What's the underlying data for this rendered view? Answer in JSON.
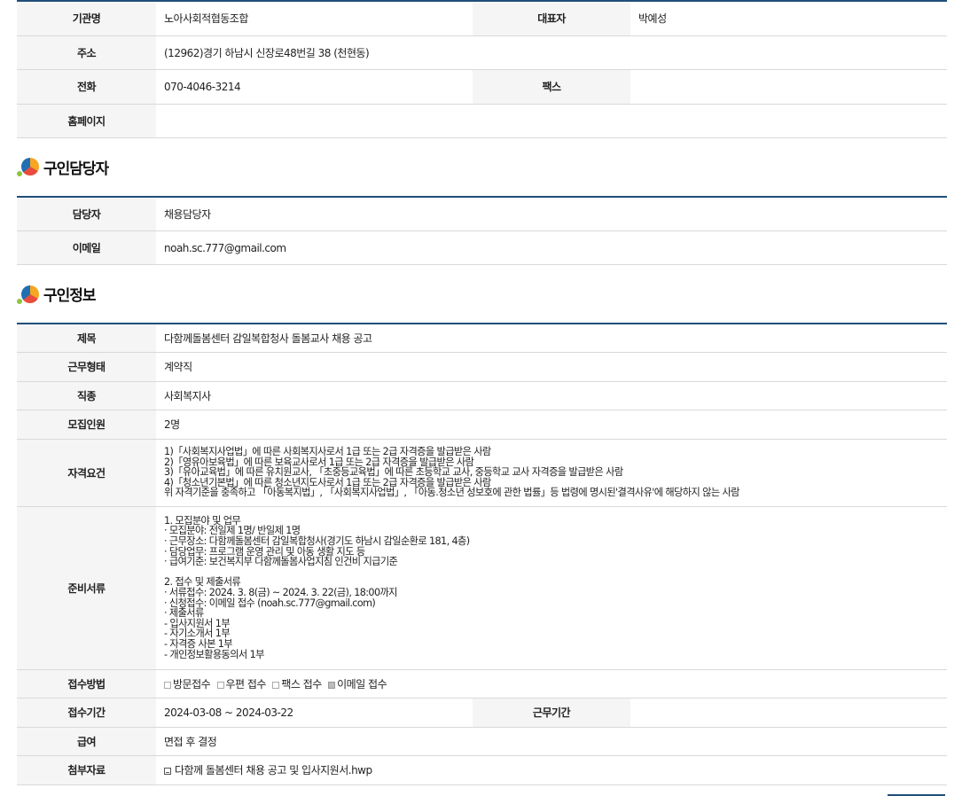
{
  "org": {
    "name_label": "기관명",
    "name_value": "노아사회적협동조합",
    "rep_label": "대표자",
    "rep_value": "박예성",
    "addr_label": "주소",
    "addr_value": "(12962)경기 하남시 신장로48번길 38 (천현동)",
    "tel_label": "전화",
    "tel_value": "070-4046-3214",
    "fax_label": "팩스",
    "fax_value": "",
    "home_label": "홈페이지",
    "home_value": ""
  },
  "contact": {
    "title": "구인담당자",
    "person_label": "담당자",
    "person_value": "채용담당자",
    "email_label": "이메일",
    "email_value": "noah.sc.777@gmail.com"
  },
  "job": {
    "title": "구인정보",
    "subject_label": "제목",
    "subject_value": "다함께돌봄센터 감일복합청사 돌봄교사 채용 공고",
    "type_label": "근무형태",
    "type_value": "계약직",
    "occ_label": "직종",
    "occ_value": "사회복지사",
    "count_label": "모집인원",
    "count_value": "2명",
    "qual_label": "자격요건",
    "qual_value": "1)「사회복지사업법」에 따른 사회복지사로서 1급 또는 2급 자격증을 발급받은 사람\n2)「영유아보육법」에 따른 보육교사로서 1급 또는 2급 자격증을 발급받은 사람\n3)「유아교육법」에 따른 유치원교사, 「초중등교육법」에 따른 초등학교 교사, 중등학교 교사 자격증을 발급받은 사람\n4)「청소년기본법」에 따른 청소년지도사로서 1급 또는 2급 자격증을 발급받은 사람\n위 자격기준을 충족하고 「아동복지법」, 「사회복지사업법」, 「아동.청소년 성보호에 관한 법률」등 법령에 명시된'결격사유'에 해당하지 않는 사람",
    "docs_label": "준비서류",
    "docs_value": "1. 모집분야 및 업무\n· 모집분야: 전일제 1명/ 반일제 1명\n· 근무장소: 다함께돌봄센터 감일복합청사(경기도 하남시 감일순환로 181, 4층)\n· 담당업무: 프로그램 운영 관리 및 아동 생활 지도 등\n· 급여기준: 보건복지부 다함께돌봄사업지침 인건비 지급기준\n\n2. 접수 및 제출서류\n· 서류접수: 2024. 3. 8(금) ~ 2024. 3. 22(금), 18:00까지\n· 신청접수: 이메일 접수 (noah.sc.777@gmail.com)\n· 제출서류\n- 입사지원서 1부\n- 자기소개서 1부\n- 자격증 사본 1부\n- 개인정보활용동의서 1부",
    "method_label": "접수방법",
    "methods": [
      {
        "label": "방문접수",
        "checked": false
      },
      {
        "label": "우편 접수",
        "checked": false
      },
      {
        "label": "팩스 접수",
        "checked": false
      },
      {
        "label": "이메일 접수",
        "checked": true
      }
    ],
    "period_label": "접수기간",
    "period_value": "2024-03-08 ~ 2024-03-22",
    "workperiod_label": "근무기간",
    "workperiod_value": "",
    "salary_label": "급여",
    "salary_value": "면접 후 결정",
    "attach_label": "첨부자료",
    "attach_value": "다함께 돌봄센터 채용 공고 및 입사지원서.hwp"
  }
}
